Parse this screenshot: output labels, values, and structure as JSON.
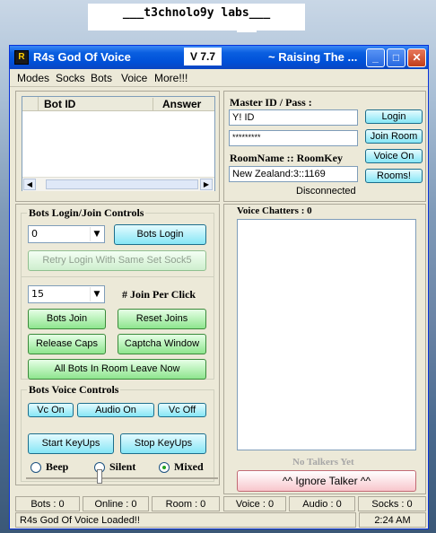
{
  "banner": "___t3chnolo9y labs___",
  "window": {
    "title": "R4s God Of Voice",
    "version": "V 7.7",
    "subtitle": "~ Raising The ...",
    "controls": {
      "min": "_",
      "max": "□",
      "close": "✕"
    }
  },
  "menu": [
    "Modes",
    "Socks",
    "Bots",
    "Voice",
    "More!!!"
  ],
  "bot_list": {
    "columns": [
      "Bot ID",
      "Answer"
    ],
    "rows": []
  },
  "login": {
    "heading": "Master  ID / Pass :",
    "id_value": "Y! ID",
    "pass_value": "*********",
    "room_heading": "RoomName :: RoomKey",
    "room_value": "New Zealand:3::1169",
    "status": "Disconnected",
    "buttons": {
      "login": "Login",
      "join_room": "Join Room",
      "voice_on": "Voice On",
      "rooms": "Rooms!"
    }
  },
  "bots_login": {
    "title": "Bots Login/Join Controls",
    "select_value": "0",
    "login_btn": "Bots Login",
    "retry_btn": "Retry Login With Same Set Sock5",
    "join_count": "15",
    "join_label": "# Join Per Click",
    "bots_join": "Bots Join",
    "reset_joins": "Reset Joins",
    "release_caps": "Release Caps",
    "captcha_window": "Captcha Window",
    "leave_all": "All Bots In Room Leave Now"
  },
  "voice_controls": {
    "title": "Bots Voice Controls",
    "vc_on": "Vc On",
    "audio_on": "Audio On",
    "vc_off": "Vc Off",
    "start_keyups": "Start KeyUps",
    "stop_keyups": "Stop KeyUps",
    "modes": [
      {
        "label": "Beep",
        "selected": false
      },
      {
        "label": "Silent",
        "selected": false
      },
      {
        "label": "Mixed",
        "selected": true
      }
    ]
  },
  "voice_chatters": {
    "title": "Voice Chatters : 0",
    "no_talkers": "No Talkers Yet",
    "ignore_btn": "^^ Ignore Talker ^^"
  },
  "status_bar": {
    "bots": "Bots : 0",
    "online": "Online : 0",
    "room": "Room : 0",
    "voice": "Voice : 0",
    "audio": "Audio : 0",
    "socks": "Socks : 0",
    "message": "R4s God Of Voice Loaded!!",
    "time": "2:24 AM"
  }
}
